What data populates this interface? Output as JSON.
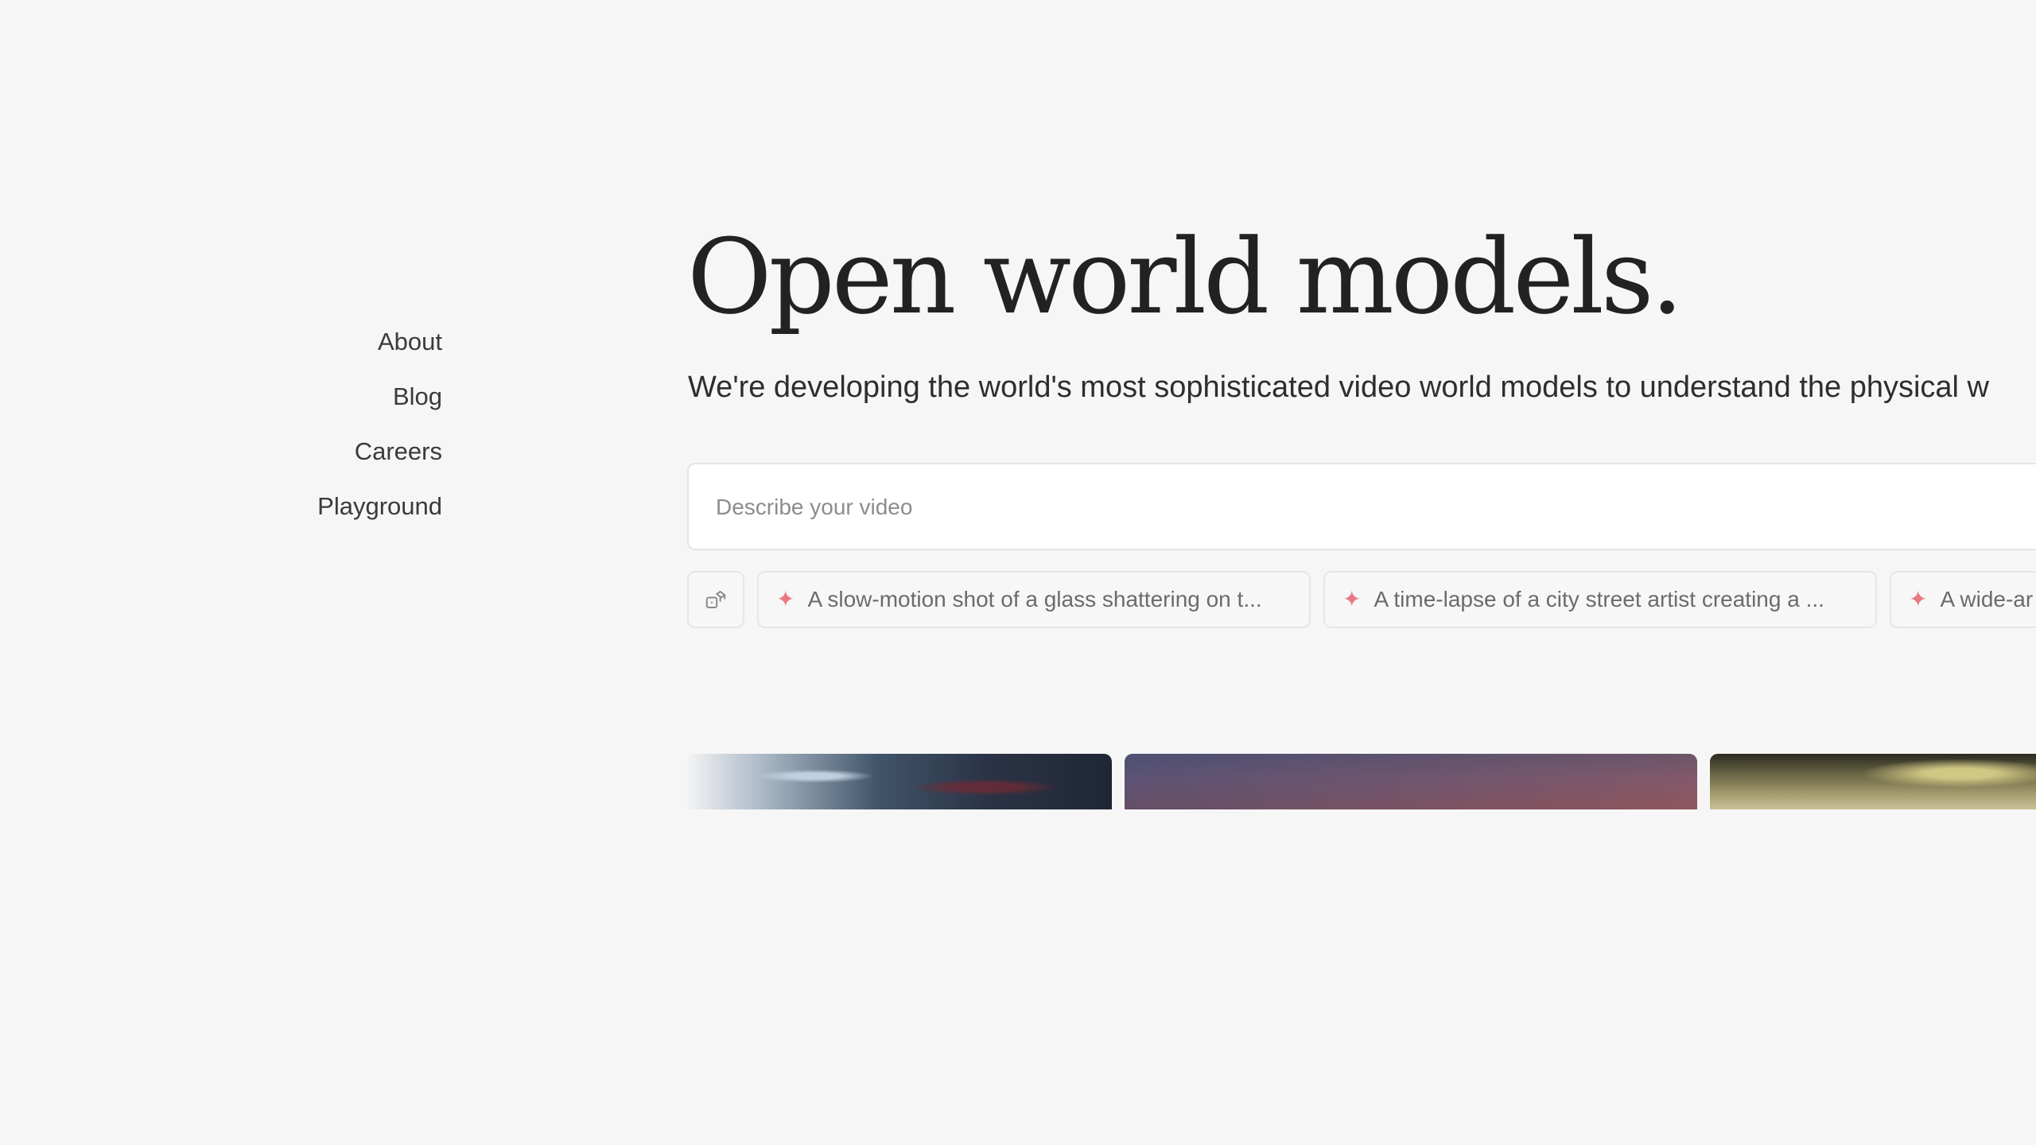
{
  "nav": {
    "items": [
      {
        "label": "About"
      },
      {
        "label": "Blog"
      },
      {
        "label": "Careers"
      },
      {
        "label": "Playground"
      }
    ]
  },
  "hero": {
    "title": "Open world models.",
    "subtitle": "We're developing the world's most sophisticated video world models to understand the physical w"
  },
  "prompt": {
    "placeholder": "Describe your video",
    "value": ""
  },
  "suggestions": {
    "shuffle_icon": "shuffle-dice-icon",
    "accent_color": "#e87a86",
    "items": [
      {
        "label": "A slow-motion shot of a glass shattering on t..."
      },
      {
        "label": "A time-lapse of a city street artist creating a ..."
      },
      {
        "label": "A wide-ar"
      }
    ]
  },
  "videos": [
    {
      "name": "video-thumb-ice"
    },
    {
      "name": "video-thumb-sky"
    },
    {
      "name": "video-thumb-ground"
    }
  ]
}
